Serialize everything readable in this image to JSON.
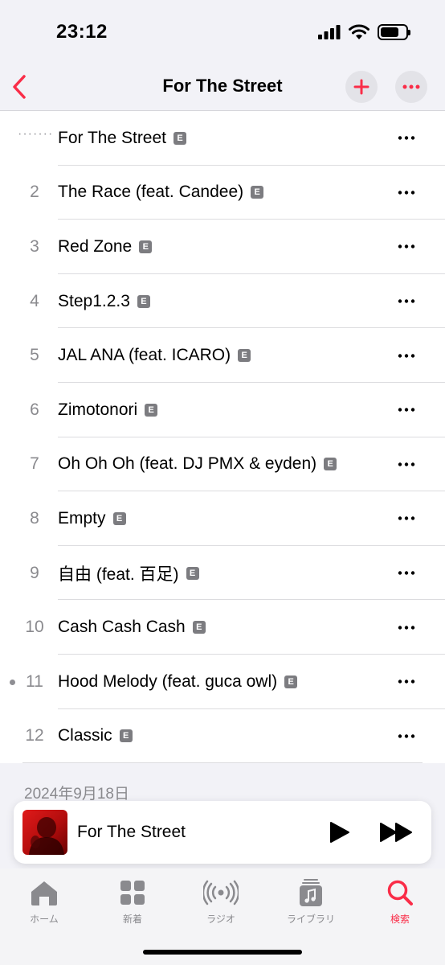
{
  "status_bar": {
    "time": "23:12"
  },
  "nav": {
    "title": "For The Street",
    "back_icon": "chevron-left-icon",
    "add_icon": "plus-icon",
    "more_icon": "ellipsis-icon"
  },
  "tracks": [
    {
      "number": "",
      "title": "For The Street",
      "explicit": "E"
    },
    {
      "number": "2",
      "title": "The Race (feat. Candee)",
      "explicit": "E"
    },
    {
      "number": "3",
      "title": "Red Zone",
      "explicit": "E"
    },
    {
      "number": "4",
      "title": "Step1.2.3",
      "explicit": "E"
    },
    {
      "number": "5",
      "title": "JAL ANA (feat. ICARO)",
      "explicit": "E"
    },
    {
      "number": "6",
      "title": "Zimotonori",
      "explicit": "E"
    },
    {
      "number": "7",
      "title": "Oh Oh Oh (feat. DJ PMX & eyden)",
      "explicit": "E"
    },
    {
      "number": "8",
      "title": "Empty",
      "explicit": "E"
    },
    {
      "number": "9",
      "title": "自由 (feat. 百足)",
      "explicit": "E"
    },
    {
      "number": "10",
      "title": "Cash Cash Cash",
      "explicit": "E"
    },
    {
      "number": "11",
      "title": "Hood Melody (feat. guca owl)",
      "explicit": "E"
    },
    {
      "number": "12",
      "title": "Classic",
      "explicit": "E"
    }
  ],
  "release_date": "2024年9月18日",
  "mini_player": {
    "title": "For The Street"
  },
  "tabs": [
    {
      "label": "ホーム",
      "icon": "home-icon"
    },
    {
      "label": "新着",
      "icon": "grid-icon"
    },
    {
      "label": "ラジオ",
      "icon": "radio-icon"
    },
    {
      "label": "ライブラリ",
      "icon": "library-icon"
    },
    {
      "label": "検索",
      "icon": "search-icon"
    }
  ],
  "colors": {
    "accent": "#fa2d48",
    "secondary_text": "#8a8a8e",
    "background": "#f2f2f7"
  }
}
